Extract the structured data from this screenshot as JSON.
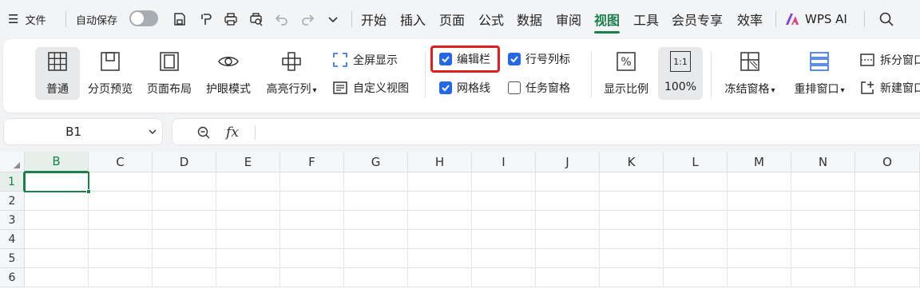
{
  "menubar": {
    "file_label": "文件",
    "autosave_label": "自动保存",
    "tabs": [
      "开始",
      "插入",
      "页面",
      "公式",
      "数据",
      "审阅",
      "视图",
      "工具",
      "会员专享",
      "效率"
    ],
    "wps_ai_label": "WPS AI"
  },
  "ribbon": {
    "normal": "普通",
    "page_break_preview": "分页预览",
    "page_layout": "页面布局",
    "eye_protection": "护眼模式",
    "highlight_rowcol": "高亮行列",
    "fullscreen": "全屏显示",
    "custom_view": "自定义视图",
    "formula_bar": "编辑栏",
    "row_col_headers": "行号列标",
    "gridlines": "网格线",
    "task_pane": "任务窗格",
    "zoom_ratio": "显示比例",
    "zoom_100": "100%",
    "zoom_100_icon_text": "1:1",
    "freeze_panes": "冻结窗格",
    "rearrange_windows": "重排窗口",
    "split_window": "拆分窗口",
    "new_window": "新建窗口"
  },
  "formula_bar": {
    "name_box": "B1",
    "fx_label": "fx",
    "content": ""
  },
  "sheet": {
    "columns": [
      "B",
      "C",
      "D",
      "E",
      "F",
      "G",
      "H",
      "I",
      "J",
      "K",
      "L",
      "M",
      "N",
      "O"
    ],
    "rows": [
      "1",
      "2",
      "3",
      "4",
      "5",
      "6"
    ],
    "active_cell": "B1"
  },
  "colors": {
    "accent_green": "#1a7f4b",
    "checkbox_blue": "#2468e8",
    "highlight_red": "#e01e1e"
  },
  "checkboxes": {
    "formula_bar": true,
    "row_col_headers": true,
    "gridlines": true,
    "task_pane": false
  }
}
